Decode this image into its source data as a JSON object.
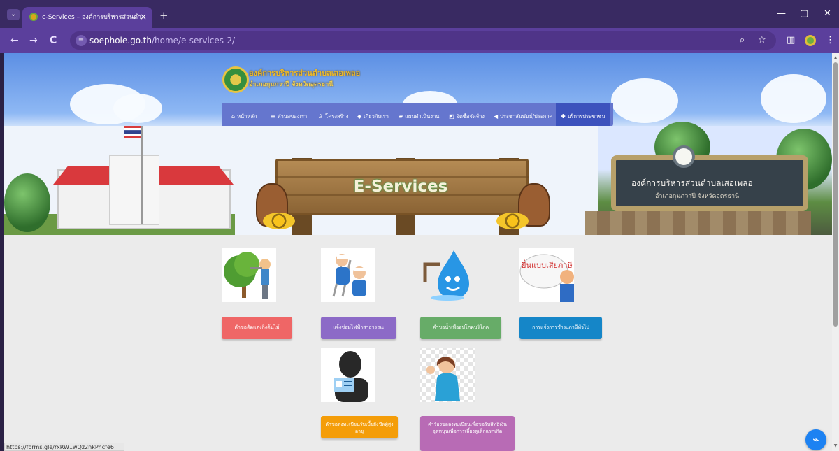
{
  "browser": {
    "tab_title": "e-Services – องค์การบริหารส่วนตำบ",
    "tab_close": "×",
    "new_tab": "+",
    "url_domain": "soephole.go.th",
    "url_path": "/home/e-services-2/",
    "window_minimize": "—",
    "window_restore": "▢",
    "window_close": "✕",
    "back": "←",
    "forward": "→",
    "reload": "C",
    "site_info": "≡",
    "zoom": "⌕",
    "bookmark": "☆",
    "sidebar": "▥",
    "menu": "⋮"
  },
  "header": {
    "org_name": "องค์การบริหารส่วนตำบลเสอเพลอ",
    "location": "อำเภอกุมภวาปี จังหวัดอุดรธานี",
    "menu": [
      {
        "label": "หน้าหลัก",
        "icon": "⌂"
      },
      {
        "label": "ตำบลของเรา",
        "icon": "≡"
      },
      {
        "label": "โครงสร้าง",
        "icon": "♙"
      },
      {
        "label": "เกี่ยวกับเรา",
        "icon": "◆"
      },
      {
        "label": "แผนดำเนินงาน",
        "icon": "▰"
      },
      {
        "label": "จัดซื้อจัดจ้าง",
        "icon": "◩"
      },
      {
        "label": "ประชาสัมพันธ์/ประกาศ",
        "icon": "◀"
      },
      {
        "label": "บริการประชาชน",
        "icon": "✚"
      }
    ]
  },
  "banner": {
    "title": "E-Services",
    "sign_name": "องค์การบริหารส่วนตำบลเสอเพลอ",
    "sign_location": "อำเภอกุมภวาปี จังหวัดอุดรธานี"
  },
  "services": [
    {
      "label": "คำขอตัดแต่งกิ่งต้นไม้",
      "color": "#ef6666"
    },
    {
      "label": "แจ้งซ่อมไฟฟ้าสาธารณะ",
      "color": "#8c6ac7"
    },
    {
      "label": "คำขอน้ำเพื่ออุปโภคบริโภค",
      "color": "#67ac68"
    },
    {
      "label": "การแจ้งการชำระภาษีทั่วไป",
      "color": "#1586c8"
    },
    {
      "label": "คำขอลงทะเบียนรับเบี้ยยังชีพผู้สูงอายุ",
      "color": "#f49d09"
    },
    {
      "label": "คำร้องขอลงทะเบียนเพื่อขอรับสิทธิเงินอุดหนุนเพื่อการเลี้ยงดูเด็กแรกเกิด",
      "color": "#b86bb5"
    }
  ],
  "tax_image_text": "ยื่นแบบเสียภาษี",
  "status_url": "https://forms.gle/rxRW1wQz2nkPhcfe6",
  "messenger_icon": "⌁"
}
